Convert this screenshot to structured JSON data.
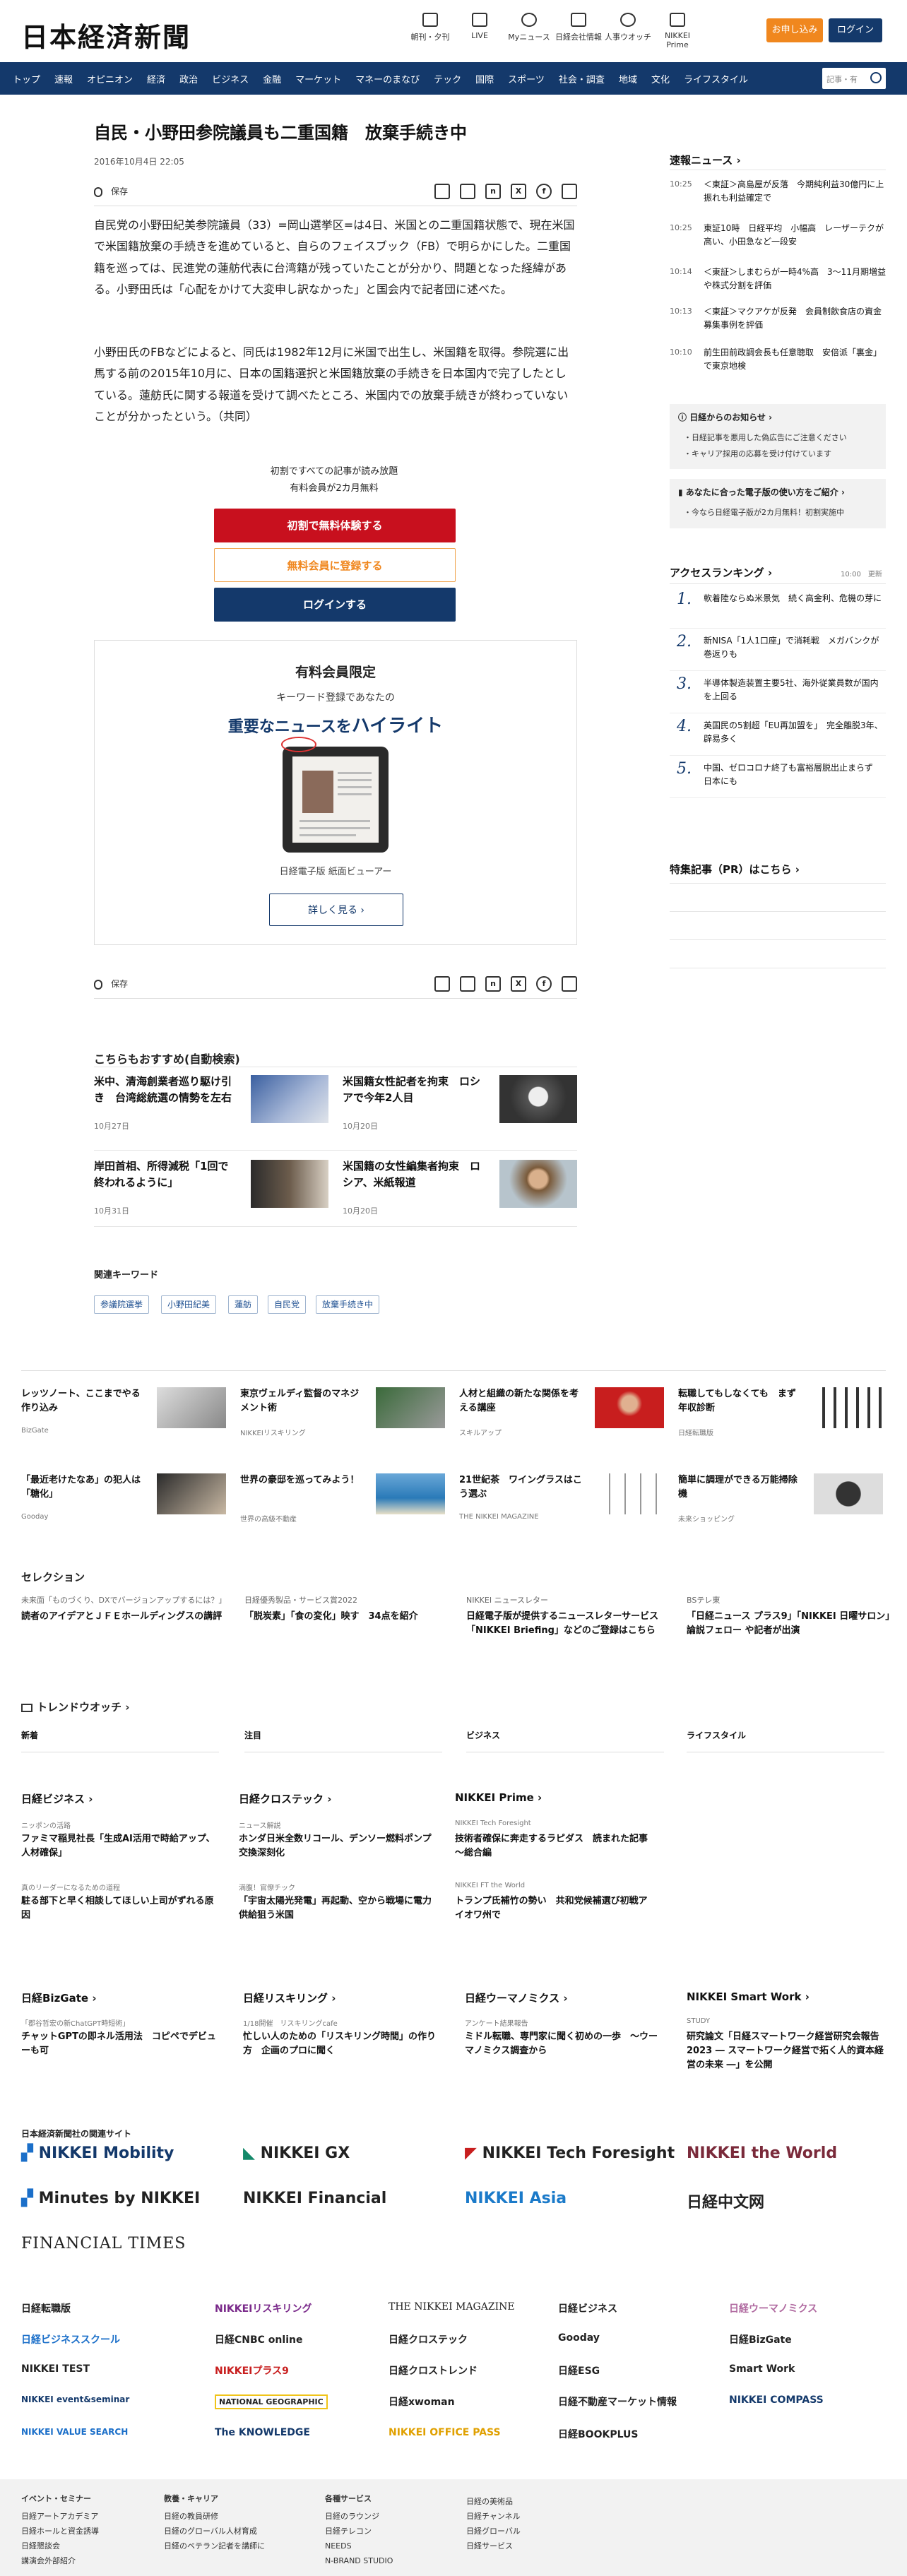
{
  "header": {
    "logo": "日本経済新聞",
    "icons": [
      {
        "label": "朝刊・夕刊",
        "icon": "newspaper-icon"
      },
      {
        "label": "LIVE",
        "icon": "video-icon"
      },
      {
        "label": "Myニュース",
        "icon": "person-icon"
      },
      {
        "label": "日経会社情報",
        "icon": "chart-icon"
      },
      {
        "label": "人事ウオッチ",
        "icon": "people-icon"
      },
      {
        "label": "NIKKEI Prime",
        "icon": "prime-icon"
      }
    ],
    "subscribe": "お申し込み",
    "login": "ログイン"
  },
  "nav": {
    "items": [
      "トップ",
      "速報",
      "オピニオン",
      "経済",
      "政治",
      "ビジネス",
      "金融",
      "マーケット",
      "マネーのまなび",
      "テック",
      "国際",
      "スポーツ",
      "社会・調査",
      "地域",
      "文化",
      "ライフスタイル"
    ],
    "search_placeholder": "記事・有"
  },
  "article": {
    "title": "自民・小野田参院議員も二重国籍　放棄手続き中",
    "date": "2016年10月4日 22:05",
    "save_label": "保存",
    "paragraphs": [
      "自民党の小野田紀美参院議員（33）=岡山選挙区=は4日、米国との二重国籍状態で、現在米国で米国籍放棄の手続きを進めていると、自らのフェイスブック（FB）で明らかにした。二重国籍を巡っては、民進党の蓮舫代表に台湾籍が残っていたことが分かり、問題となった経緯がある。小野田氏は「心配をかけて大変申し訳なかった」と国会内で記者団に述べた。",
      "小野田氏のFBなどによると、同氏は1982年12月に米国で出生し、米国籍を取得。参院選に出馬する前の2015年10月に、日本の国籍選択と米国籍放棄の手続きを日本国内で完了したとしている。蓮舫氏に関する報道を受けて調べたところ、米国内での放棄手続きが終わっていないことが分かったという。（共同）"
    ],
    "paywall_line1": "初割ですべての記事が読み放題",
    "paywall_line2": "有料会員が2カ月無料",
    "btn_trial": "初割で無料体験する",
    "btn_free": "無料会員に登録する",
    "btn_login": "ログインする"
  },
  "paid": {
    "title": "有料会員限定",
    "sub": "キーワード登録であなたの",
    "lead_a": "重要なニュースを",
    "lead_b": "ハイライト",
    "caption": "日経電子版 紙面ビューアー",
    "more": "詳しく見る"
  },
  "recommend": {
    "title": "こちらもおすすめ(自動検索)",
    "items": [
      {
        "title": "米中、清海創業者巡り駆け引き　台湾総統選の情勢を左右",
        "date": "10月27日"
      },
      {
        "title": "米国籍女性記者を拘束　ロシアで今年2人目",
        "date": "10月20日"
      },
      {
        "title": "岸田首相、所得減税「1回で終われるように」",
        "date": "10月31日"
      },
      {
        "title": "米国籍の女性編集者拘束　ロシア、米紙報道",
        "date": "10月20日"
      }
    ]
  },
  "keywords": {
    "label": "関連キーワード",
    "items": [
      "参議院選挙",
      "小野田紀美",
      "蓮舫",
      "自民党",
      "放棄手続き中"
    ]
  },
  "sidebar": {
    "flash_title": "速報ニュース",
    "flash": [
      {
        "time": "10:25",
        "text": "＜東証＞高島屋が反落　今期純利益30億円に上振れも利益確定で"
      },
      {
        "time": "10:25",
        "text": "東証10時　日経平均　小幅高　レーザーテクが高い、小田急など一段安"
      },
      {
        "time": "10:14",
        "text": "＜東証＞しまむらが一時4%高　3～11月期増益や株式分割を評価"
      },
      {
        "time": "10:13",
        "text": "＜東証＞マクアケが反発　会員制飲食店の資金募集事例を評価"
      },
      {
        "time": "10:10",
        "text": "前生田前政調会長も任意聴取　安倍派「裏金」で東京地検"
      }
    ],
    "notice_title": "日経からのお知らせ",
    "notices": [
      "・日経記事を悪用した偽広告にご注意ください",
      "・キャリア採用の応募を受け付けています"
    ],
    "notice2_title": "あなたに合った電子版の使い方をご紹介",
    "notices2": [
      "・今なら日経電子版が2カ月無料！初割実施中"
    ],
    "rank_title": "アクセスランキング",
    "rank_time": "10:00　更新",
    "ranks": [
      {
        "n": "1.",
        "text": "軟着陸ならぬ米景気　続く高金利、危機の芽に"
      },
      {
        "n": "2.",
        "text": "新NISA「1人1口座」で消耗戦　メガバンクが巻返りも"
      },
      {
        "n": "3.",
        "text": "半導体製造装置主要5社、海外従業員数が国内を上回る"
      },
      {
        "n": "4.",
        "text": "英国民の5割超「EU再加盟を」　完全離脱3年、辟易多く"
      },
      {
        "n": "5.",
        "text": "中国、ゼロコロナ終了も富裕層脱出止まらず　日本にも"
      }
    ],
    "pr_title": "特集記事（PR）はこちら"
  },
  "ads": [
    {
      "title": "レッツノート、ここまでやる作り込み",
      "source": "BizGate"
    },
    {
      "title": "東京ヴェルディ監督のマネジメント術",
      "source": "NIKKEIリスキリング"
    },
    {
      "title": "人材と組織の新たな関係を考える講座",
      "source": "スキルアップ"
    },
    {
      "title": "転職してもしなくても　まず年収診断",
      "source": "日経転職版"
    },
    {
      "title": "「最近老けたなあ」の犯人は「糖化」",
      "source": "Gooday"
    },
    {
      "title": "世界の豪邸を巡ってみよう！",
      "source": "世界の高級不動産"
    },
    {
      "title": "21世紀茶　ワイングラスはこう選ぶ",
      "source": "THE NIKKEI MAGAZINE"
    },
    {
      "title": "簡単に調理ができる万能掃除機",
      "source": "未来ショッピング"
    }
  ],
  "selection": {
    "title": "セレクション",
    "cols": [
      {
        "src": "未来面「ものづくり、DXでバージョンアップするには？」",
        "title": "読者のアイデアとＪＦＥホールディングスの講評"
      },
      {
        "src": "日経優秀製品・サービス賞2022",
        "title": "「脱炭素」「食の変化」映す　34点を紹介"
      },
      {
        "src": "NIKKEI ニュースレター",
        "title": "日経電子版が提供するニュースレターサービス「NIKKEI Briefing」などのご登録はこちら"
      },
      {
        "src": "BSテレ東",
        "title": "「日経ニュース プラス9」「NIKKEI 日曜サロン」論説フェロー や記者が出演"
      }
    ]
  },
  "trend": {
    "title": "トレンドウオッチ",
    "cats": [
      "新着",
      "注目",
      "ビジネス",
      "ライフスタイル"
    ]
  },
  "blocks": [
    {
      "head": "日経ビジネス",
      "s1": "ニッポンの活路",
      "t1": "ファミマ稲見社長「生成AI活用で時給アップ、人材確保」",
      "s2": "真のリーダーになるための道程",
      "t2": "駐る部下と早く相談してほしい上司がずれる原因"
    },
    {
      "head": "日経クロステック",
      "s1": "ニュース解説",
      "t1": "ホンダ日米全数リコール、デンソー燃料ポンプ交換深刻化",
      "s2": "満腹！官僚チック",
      "t2": "「宇宙太陽光発電」再起動、空から戦場に電力供給狙う米国"
    },
    {
      "head": "NIKKEI Prime",
      "s1": "NIKKEI Tech Foresight",
      "t1": "技術者確保に奔走するラピダス　読まれた記事～総合編",
      "s2": "NIKKEI FT the World",
      "t2": "トランプ氏補竹の勢い　共和党候補選び初戦アイオワ州で"
    },
    {
      "head": "日経BizGate",
      "s1": "「郡谷哲宏の新ChatGPT時短術」",
      "t1": "チャットGPTの即ネル活用法　コピペでデビューも可",
      "s2": "",
      "t2": ""
    },
    {
      "head": "日経リスキリング",
      "s1": "1/18開催　リスキリングcafe",
      "t1": "忙しい人のための「リスキリング時間」の作り方　企画のプロに聞く",
      "s2": "",
      "t2": ""
    },
    {
      "head": "日経ウーマノミクス",
      "s1": "アンケート結果報告",
      "t1": "ミドル転職、専門家に聞く初めの一歩　～ウーマノミクス調査から",
      "s2": "",
      "t2": ""
    },
    {
      "head": "NIKKEI Smart Work",
      "s1": "STUDY",
      "t1": "研究論文「日経スマートワーク経営研究会報告2023 ― スマートワーク経営で拓く人的資本経営の未来 ―」を公開",
      "s2": "",
      "t2": ""
    }
  ],
  "related": {
    "title": "日本経済新聞社の関連サイト",
    "big": [
      "NIKKEI Mobility",
      "NIKKEI GX",
      "NIKKEI Tech Foresight",
      "NIKKEI the World",
      "Minutes by NIKKEI",
      "NIKKEI Financial",
      "NIKKEI Asia",
      "日経中文网"
    ],
    "ft": "FINANCIAL TIMES",
    "small": [
      "日経転職版",
      "NIKKEIリスキリング",
      "THE NIKKEI MAGAZINE",
      "日経ビジネス",
      "日経ウーマノミクス",
      "日経ビジネススクール",
      "日経CNBC online",
      "日経クロステック",
      "Gooday",
      "日経BizGate",
      "NIKKEI TEST",
      "NIKKEIプラス9",
      "日経クロストレンド",
      "日経ESG",
      "Smart Work",
      "NIKKEI event&seminar",
      "NATIONAL GEOGRAPHIC",
      "日経xwoman",
      "日経不動産マーケット情報",
      "NIKKEI COMPASS",
      "NIKKEI VALUE SEARCH",
      "The KNOWLEDGE",
      "NIKKEI OFFICE PASS",
      "日経BOOKPLUS"
    ]
  },
  "footer": {
    "cols": [
      {
        "h": "イベント・セミナー",
        "items": [
          "日経アートアカデミア",
          "日経ホールと資金誘導",
          "日経懇談会",
          "講演会外部紹介"
        ]
      },
      {
        "h": "教養・キャリア",
        "items": [
          "日経の教員研修",
          "日経のグローバル人材育成",
          "日経のベテラン記者を講師に"
        ]
      },
      {
        "h": "各種サービス",
        "items": [
          "日経のラウンジ",
          "日経テレコン",
          "NEEDS",
          "N-BRAND STUDIO"
        ]
      },
      {
        "h": "",
        "items": [
          "日経の美術品",
          "日経チャンネル",
          "日経グローバル",
          "日経サービス"
        ]
      }
    ]
  }
}
